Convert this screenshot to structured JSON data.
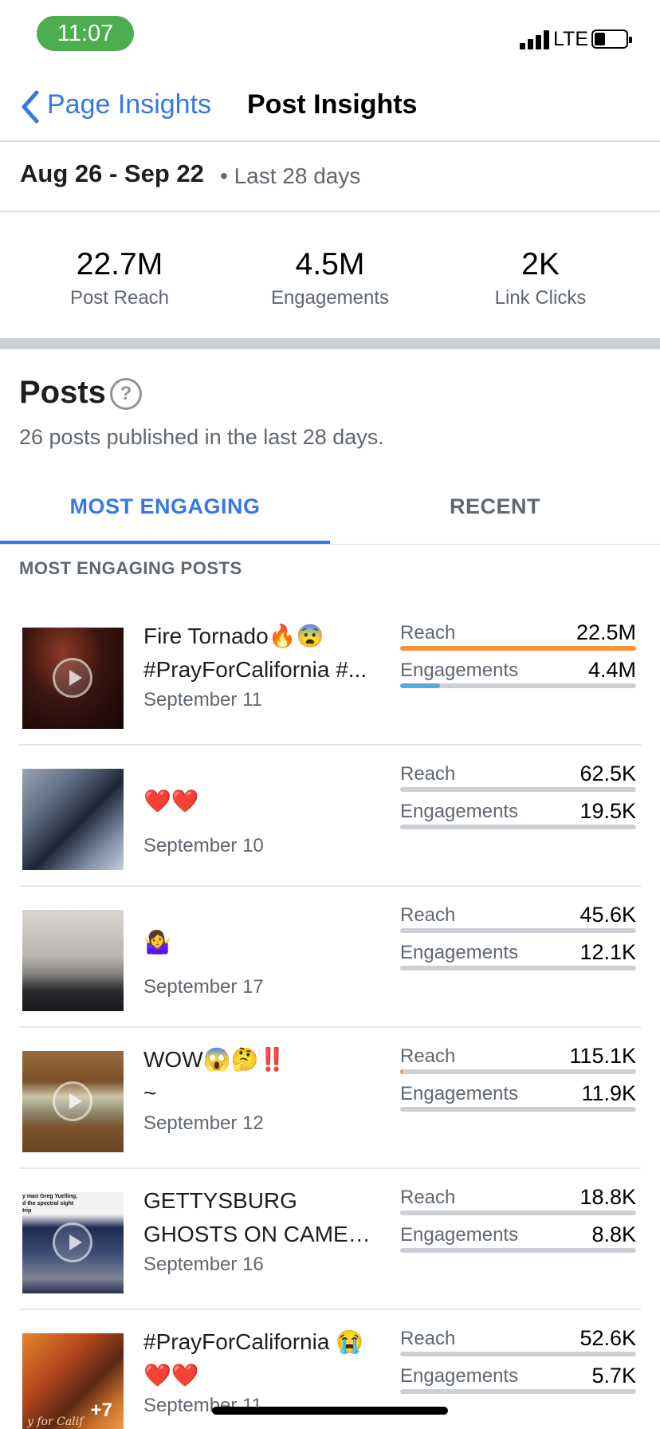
{
  "status_bar": {
    "time": "11:07",
    "network": "LTE"
  },
  "nav": {
    "back_label": "Page Insights",
    "title": "Post Insights"
  },
  "date_range": {
    "range": "Aug 26 - Sep 22",
    "separator": "•",
    "period": "Last 28 days"
  },
  "stats": [
    {
      "value": "22.7M",
      "label": "Post Reach"
    },
    {
      "value": "4.5M",
      "label": "Engagements"
    },
    {
      "value": "2K",
      "label": "Link Clicks"
    }
  ],
  "posts_section": {
    "title": "Posts",
    "help_symbol": "?",
    "subtitle": "26 posts published in the last 28 days.",
    "tabs": {
      "active": "MOST ENGAGING",
      "inactive": "RECENT"
    },
    "list_label": "MOST ENGAGING POSTS"
  },
  "metric_labels": {
    "reach": "Reach",
    "engagements": "Engagements"
  },
  "colors": {
    "accent": "#3578e5",
    "reach_fill": "#f7923a",
    "engagement_fill": "#4fb0e0",
    "track": "#ccd0d5"
  },
  "posts": [
    {
      "caption_lines": [
        "Fire Tornado🔥😨",
        "#PrayForCalifornia #..."
      ],
      "date": "September 11",
      "reach": "22.5M",
      "engagements": "4.4M",
      "reach_fraction": 1.0,
      "engagement_fraction": 0.17,
      "video": true,
      "extra_count": "",
      "thumb_icon": "fire-tornado-thumbnail"
    },
    {
      "caption_lines": [
        "❤️❤️"
      ],
      "date": "September 10",
      "reach": "62.5K",
      "engagements": "19.5K",
      "reach_fraction": 0.0,
      "engagement_fraction": 0.0,
      "video": false,
      "extra_count": "",
      "thumb_icon": "ice-water-thumbnail"
    },
    {
      "caption_lines": [
        "🤷‍♀️"
      ],
      "date": "September 17",
      "reach": "45.6K",
      "engagements": "12.1K",
      "reach_fraction": 0.0,
      "engagement_fraction": 0.0,
      "video": false,
      "extra_count": "",
      "thumb_icon": "pot-on-stove-thumbnail"
    },
    {
      "caption_lines": [
        "WOW😱🤔‼️",
        "~"
      ],
      "date": "September 12",
      "reach": "115.1K",
      "engagements": "11.9K",
      "reach_fraction": 0.005,
      "engagement_fraction": 0.0,
      "video": true,
      "extra_count": "",
      "thumb_icon": "dollar-bill-thumbnail"
    },
    {
      "caption_lines": [
        "GETTYSBURG",
        "GHOSTS ON CAMER..."
      ],
      "date": "September 16",
      "reach": "18.8K",
      "engagements": "8.8K",
      "reach_fraction": 0.0,
      "engagement_fraction": 0.0,
      "video": true,
      "extra_count": "",
      "thumb_icon": "night-road-thumbnail",
      "thumb_text": [
        "y man Greg Yuelling,",
        "d the spectral sight",
        "trip"
      ]
    },
    {
      "caption_lines": [
        "#PrayForCalifornia 😭",
        "❤️❤️"
      ],
      "date": "September 11",
      "reach": "52.6K",
      "engagements": "5.7K",
      "reach_fraction": 0.0,
      "engagement_fraction": 0.0,
      "video": false,
      "extra_count": "+7",
      "thumb_icon": "wildfire-collage-thumbnail",
      "thumb_text": [
        "y for Calif"
      ]
    }
  ]
}
